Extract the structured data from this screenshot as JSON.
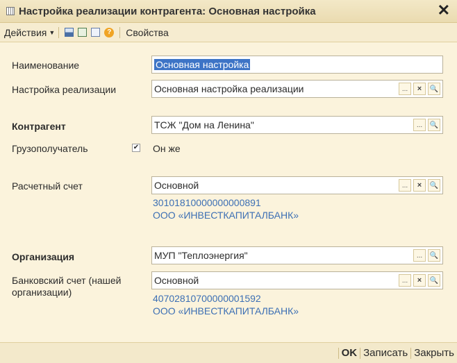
{
  "window": {
    "title": "Настройка реализации контрагента: Основная настройка",
    "close": "✕"
  },
  "toolbar": {
    "actions": "Действия",
    "properties": "Свойства",
    "help_symbol": "?"
  },
  "form": {
    "name": {
      "label": "Наименование",
      "value": "Основная настройка"
    },
    "sales_setting": {
      "label": "Настройка реализации",
      "value": "Основная настройка реализации"
    },
    "counterparty": {
      "label": "Контрагент",
      "value": "ТСЖ \"Дом на Ленина\""
    },
    "consignee": {
      "label": "Грузополучатель",
      "value": "Он же",
      "checked": true,
      "check_mark": "✔"
    },
    "settlement_account": {
      "label": "Расчетный счет",
      "value": "Основной",
      "number": "30101810000000000891",
      "bank": "ООО «ИНВЕСТКАПИТАЛБАНК»"
    },
    "organization": {
      "label": "Организация",
      "value": "МУП \"Теплоэнергия\""
    },
    "bank_account": {
      "label_line1": "Банковский счет (нашей",
      "label_line2": "организации)",
      "value": "Основной",
      "number": "40702810700000001592",
      "bank": "ООО «ИНВЕСТКАПИТАЛБАНК»"
    }
  },
  "buttons": {
    "select": "...",
    "clear": "×",
    "open": "🔍"
  },
  "footer": {
    "ok": "OK",
    "save": "Записать",
    "close": "Закрыть"
  }
}
